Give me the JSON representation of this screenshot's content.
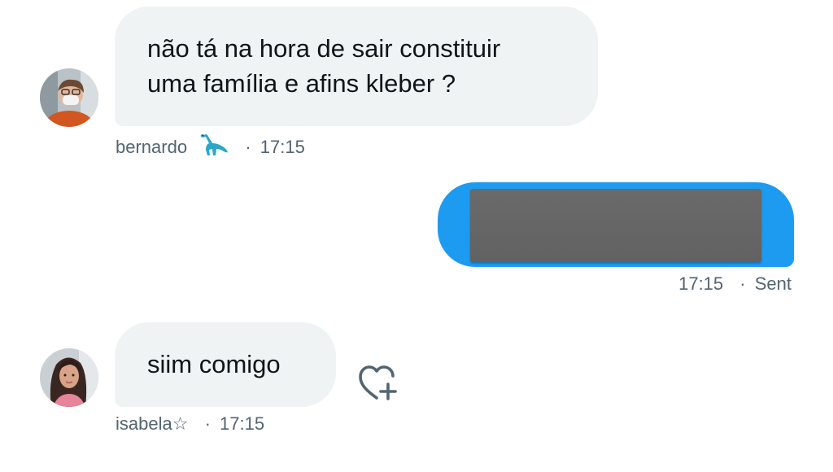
{
  "messages": [
    {
      "sender": "bernardo",
      "sender_badge": "sauropod-emoji",
      "text_line1": "não tá na hora de sair constituir",
      "text_line2": "uma família e afins kleber ?",
      "time": "17:15",
      "separator": "·"
    },
    {
      "direction": "sent",
      "content": "redacted-image",
      "time": "17:15",
      "status": "Sent",
      "separator": "·"
    },
    {
      "sender": "isabela☆",
      "text": "siim comigo",
      "time": "17:15",
      "separator": "·",
      "reaction_icon": "heart-plus-icon"
    }
  ],
  "colors": {
    "incoming_bubble": "#eff3f4",
    "outgoing_bubble": "#1d9bf0",
    "meta_text": "#536471",
    "message_text": "#0f1419"
  }
}
